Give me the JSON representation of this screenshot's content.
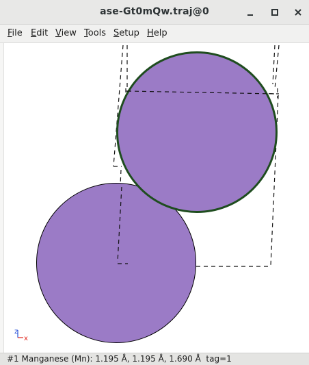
{
  "window": {
    "title": "ase-Gt0mQw.traj@0"
  },
  "controls": {
    "minimize_icon": "minimize-icon",
    "maximize_icon": "maximize-icon",
    "close_icon": "close-icon"
  },
  "menu": [
    {
      "label": "File"
    },
    {
      "label": "Edit"
    },
    {
      "label": "View"
    },
    {
      "label": "Tools"
    },
    {
      "label": "Setup"
    },
    {
      "label": "Help"
    }
  ],
  "viewer": {
    "atoms": [
      {
        "index": 0,
        "element": "Mn",
        "color": "#9b7bc6",
        "selected": false
      },
      {
        "index": 1,
        "element": "Mn",
        "color": "#9b7bc6",
        "selected": true,
        "highlight_color": "#1f4d1f"
      }
    ],
    "axes": {
      "x_label": "x",
      "z_label": "z",
      "x_color": "#e0241b",
      "z_color": "#2952d8"
    }
  },
  "status": {
    "text": "#1 Manganese (Mn): 1.195 Å, 1.195 Å, 1.690 Å  tag=1"
  }
}
